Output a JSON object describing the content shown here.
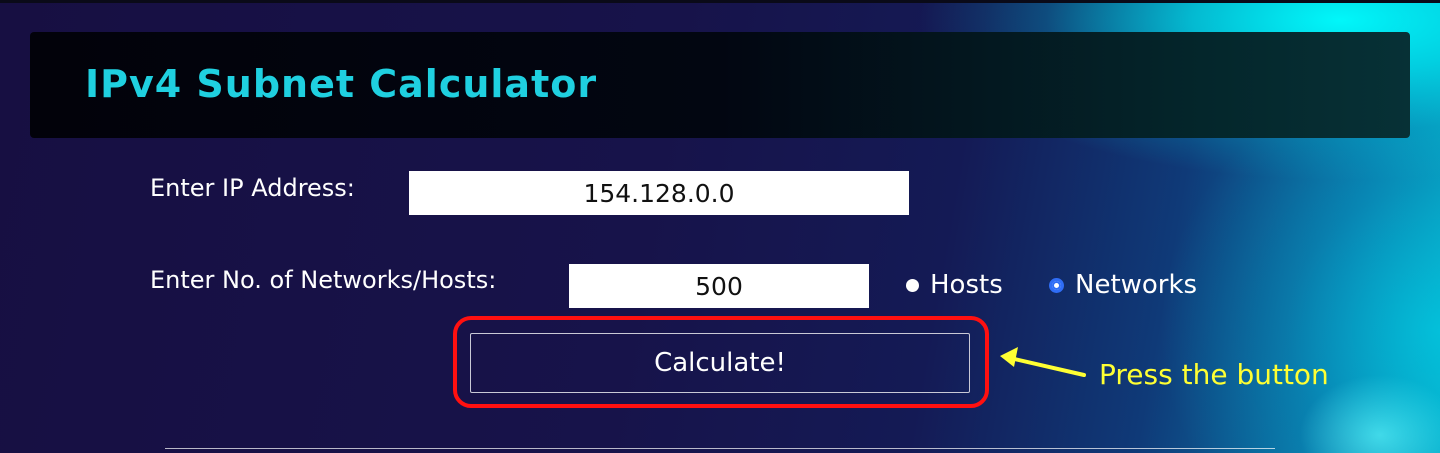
{
  "header": {
    "title": "IPv4 Subnet Calculator"
  },
  "form": {
    "ip_label": "Enter IP Address:",
    "ip_value": "154.128.0.0",
    "count_label": "Enter No. of Networks/Hosts:",
    "count_value": "500",
    "radio_options": [
      {
        "label": "Hosts",
        "checked": false
      },
      {
        "label": "Networks",
        "checked": true
      }
    ],
    "calculate_label": "Calculate!"
  },
  "annotation": {
    "text": "Press the button",
    "color": "#ffff33",
    "highlight_color": "#ff1010"
  },
  "colors": {
    "title": "#1fd0e0",
    "radio_selected": "#2f6df6"
  }
}
